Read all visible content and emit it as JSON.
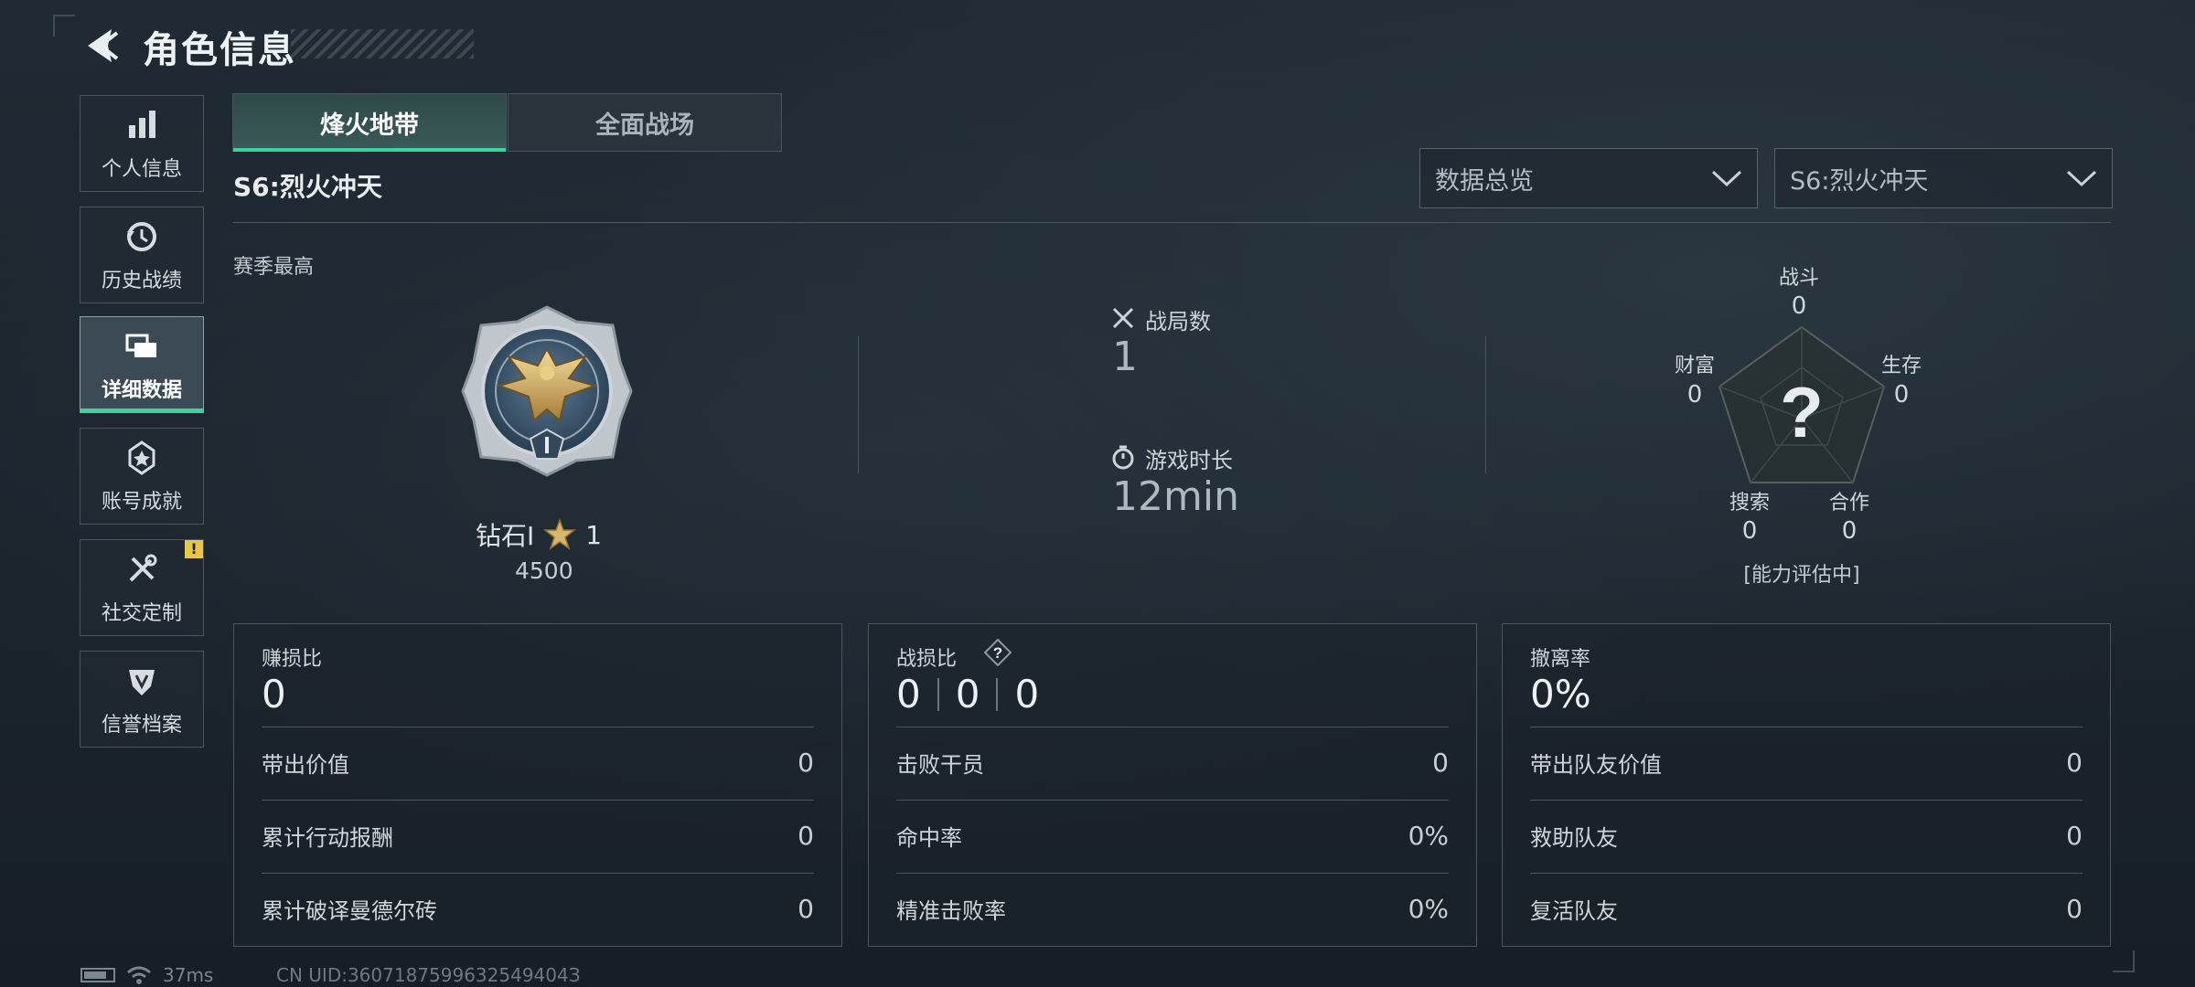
{
  "header": {
    "title": "角色信息"
  },
  "sidebar": {
    "items": [
      {
        "label": "个人信息",
        "icon": "bar-chart-icon",
        "active": false
      },
      {
        "label": "历史战绩",
        "icon": "history-icon",
        "active": false
      },
      {
        "label": "详细数据",
        "icon": "cards-icon",
        "active": true
      },
      {
        "label": "账号成就",
        "icon": "achievement-icon",
        "active": false
      },
      {
        "label": "社交定制",
        "icon": "tools-icon",
        "active": false,
        "badge": "!"
      },
      {
        "label": "信誉档案",
        "icon": "shield-icon",
        "active": false
      }
    ]
  },
  "tabs": [
    {
      "label": "烽火地带",
      "active": true
    },
    {
      "label": "全面战场",
      "active": false
    }
  ],
  "season_title": "S6:烈火冲天",
  "filters": {
    "view": "数据总览",
    "season": "S6:烈火冲天"
  },
  "rank": {
    "section_label": "赛季最高",
    "tier": "钻石I",
    "stars": "1",
    "score": "4500"
  },
  "overview": {
    "matches_label": "战局数",
    "matches_value": "1",
    "playtime_label": "游戏时长",
    "playtime_value": "12min"
  },
  "radar": {
    "combat_label": "战斗",
    "combat_value": "0",
    "survival_label": "生存",
    "survival_value": "0",
    "teamwork_label": "合作",
    "teamwork_value": "0",
    "search_label": "搜索",
    "search_value": "0",
    "wealth_label": "财富",
    "wealth_value": "0",
    "center_mark": "?",
    "status": "[能力评估中]"
  },
  "cards": {
    "profit": {
      "title": "赚损比",
      "value": "0",
      "rows": [
        {
          "label": "带出价值",
          "value": "0"
        },
        {
          "label": "累计行动报酬",
          "value": "0"
        },
        {
          "label": "累计破译曼德尔砖",
          "value": "0"
        }
      ]
    },
    "combat": {
      "title": "战损比",
      "values": [
        "0",
        "0",
        "0"
      ],
      "rows": [
        {
          "label": "击败干员",
          "value": "0"
        },
        {
          "label": "命中率",
          "value": "0%"
        },
        {
          "label": "精准击败率",
          "value": "0%"
        }
      ]
    },
    "extract": {
      "title": "撤离率",
      "value": "0%",
      "rows": [
        {
          "label": "带出队友价值",
          "value": "0"
        },
        {
          "label": "救助队友",
          "value": "0"
        },
        {
          "label": "复活队友",
          "value": "0"
        }
      ]
    }
  },
  "footer": {
    "ping": "37ms",
    "uid": "CN UID:3607187599632549404З"
  }
}
